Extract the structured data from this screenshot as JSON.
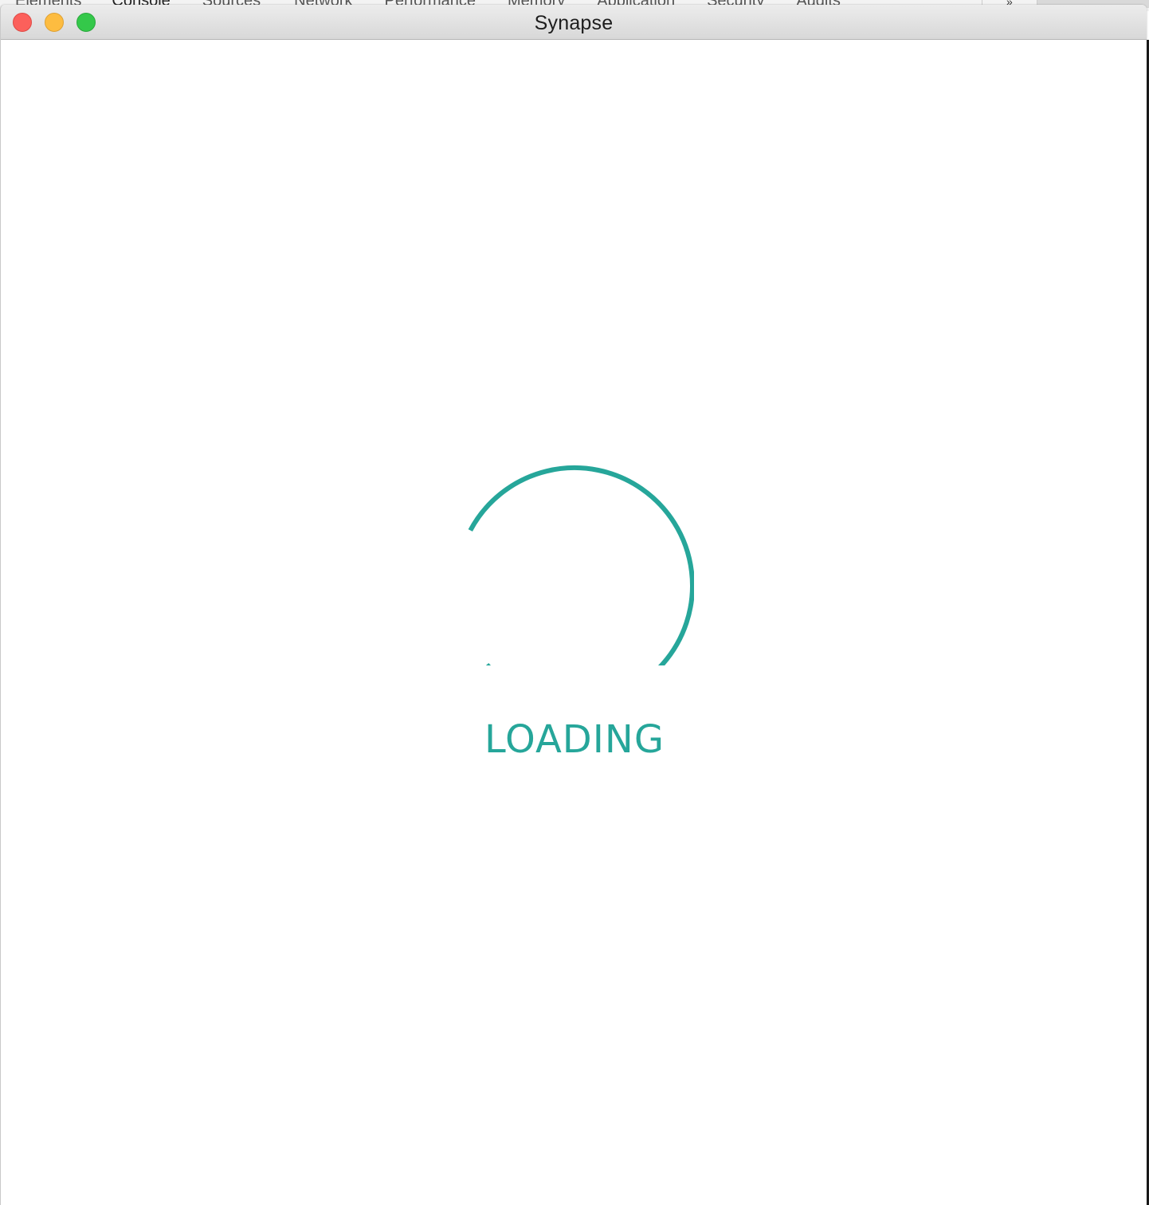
{
  "background_devtools": {
    "tabs": [
      "Elements",
      "Console",
      "Sources",
      "Network",
      "Performance",
      "Memory",
      "Application",
      "Security",
      "Audits"
    ],
    "more_label": "»"
  },
  "window": {
    "title": "Synapse"
  },
  "loader": {
    "text": "LOADING",
    "accent_color": "#26a69a"
  }
}
